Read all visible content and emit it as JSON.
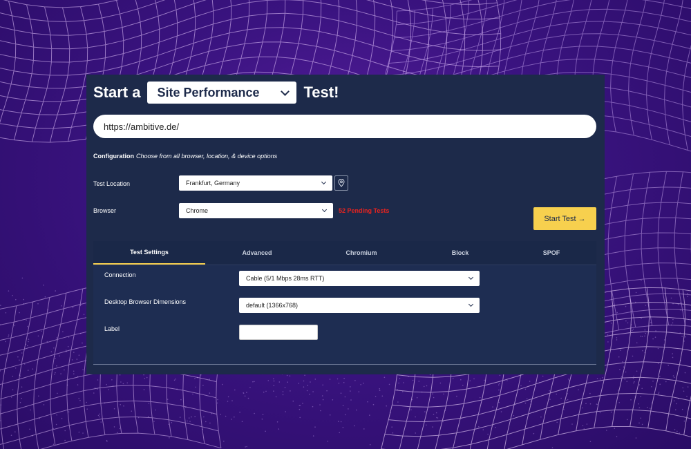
{
  "header": {
    "prefix": "Start a",
    "test_type": "Site Performance",
    "suffix": "Test!"
  },
  "url_input": {
    "value": "https://ambitive.de/"
  },
  "configuration": {
    "label": "Configuration",
    "hint": "Choose from all browser, location, & device options"
  },
  "test_location": {
    "label": "Test Location",
    "value": "Frankfurt, Germany",
    "icon": "map-pin-icon"
  },
  "browser": {
    "label": "Browser",
    "value": "Chrome",
    "pending": "52 Pending Tests"
  },
  "start_button": {
    "label": "Start Test →"
  },
  "tabs": [
    {
      "label": "Test Settings",
      "active": true
    },
    {
      "label": "Advanced"
    },
    {
      "label": "Chromium"
    },
    {
      "label": "Block"
    },
    {
      "label": "SPOF"
    }
  ],
  "settings": {
    "connection": {
      "label": "Connection",
      "value": "Cable (5/1 Mbps 28ms RTT)"
    },
    "dimensions": {
      "label": "Desktop Browser Dimensions",
      "value": "default (1366x768)"
    },
    "label_field": {
      "label": "Label",
      "value": ""
    }
  },
  "colors": {
    "panel": "#1d2a4a",
    "accent": "#f7d04e",
    "pending": "#e8231f",
    "background": "#3a1380"
  }
}
